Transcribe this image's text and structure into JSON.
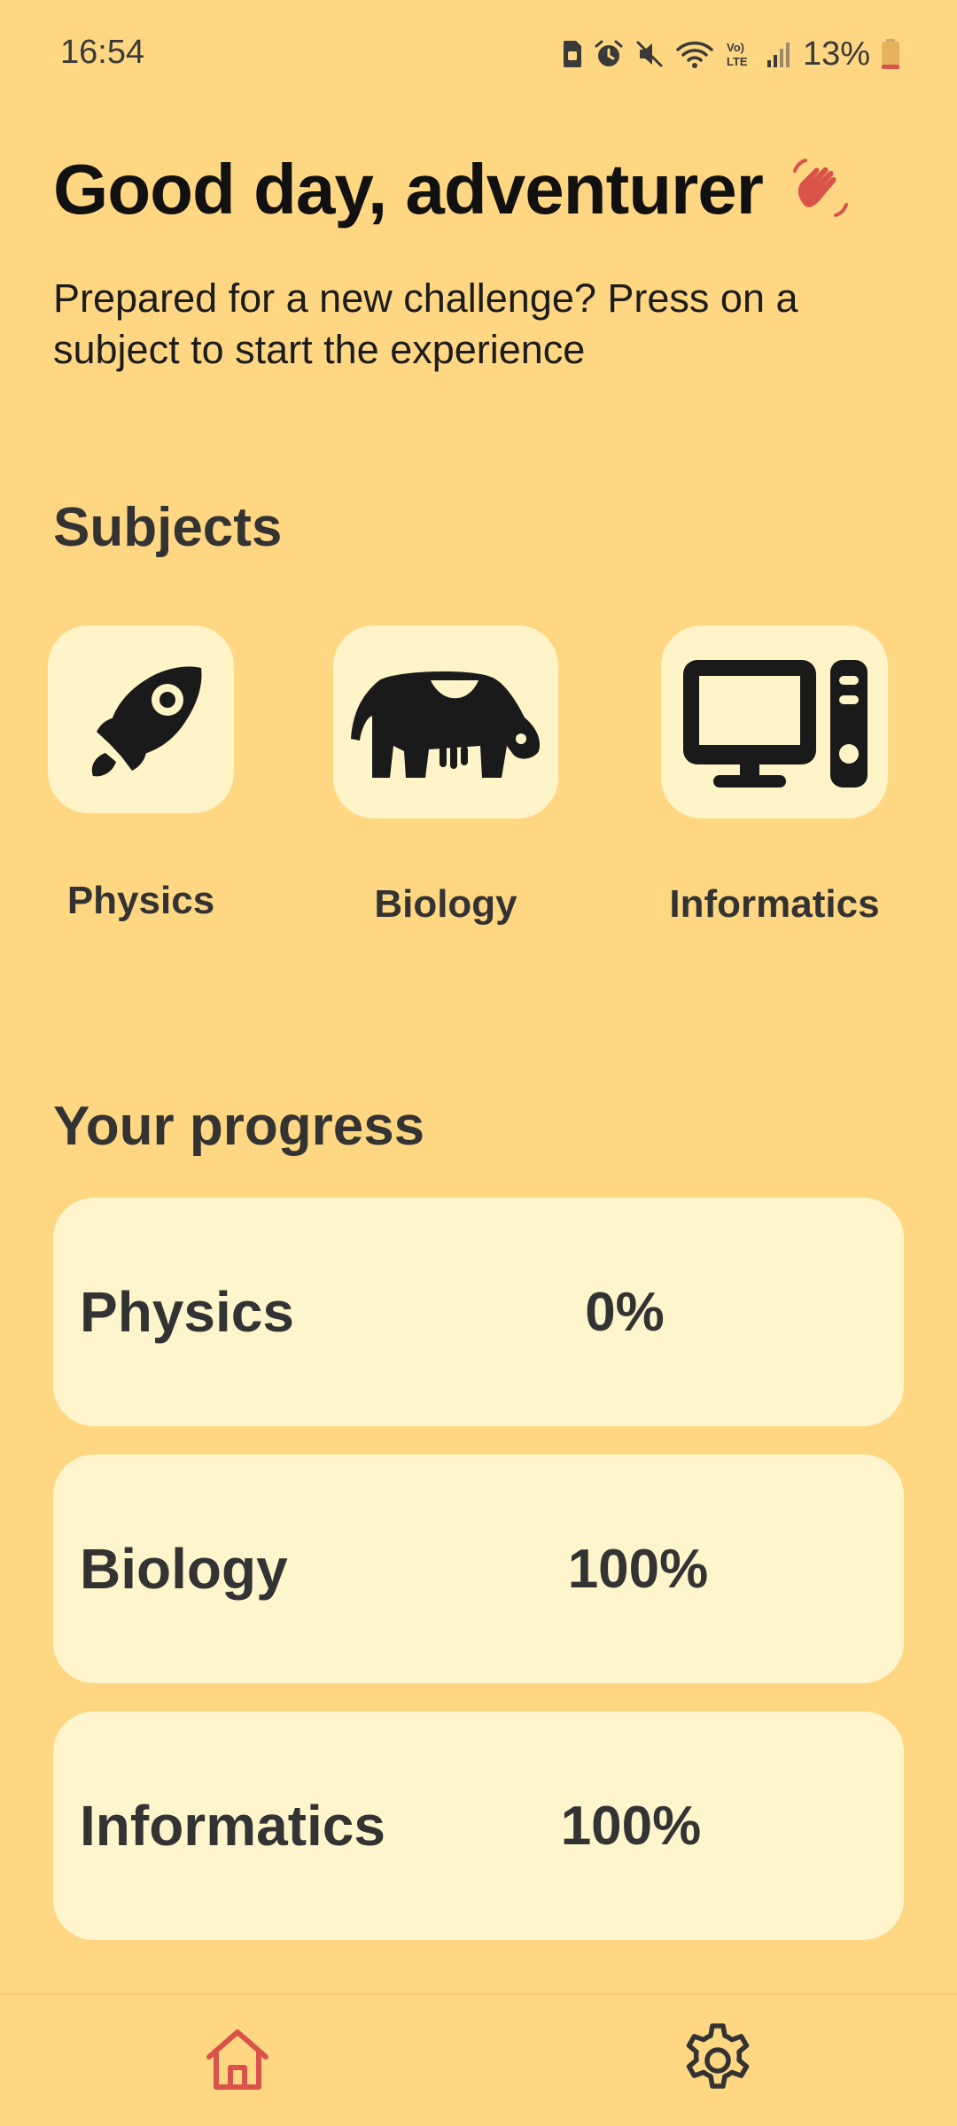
{
  "status_bar": {
    "time": "16:54",
    "battery_percent": "13%",
    "icons": [
      "sim-card-icon",
      "alarm-icon",
      "mute-icon",
      "wifi-icon",
      "volte-icon",
      "signal-icon",
      "battery-icon"
    ],
    "volte_label": "Vo) LTE"
  },
  "header": {
    "greeting": "Good day, adventurer",
    "greeting_icon": "waving-hand-icon",
    "subtitle": "Prepared for a new challenge? Press on a subject to start the experience"
  },
  "subjects": {
    "title": "Subjects",
    "items": [
      {
        "label": "Physics",
        "icon": "rocket-icon"
      },
      {
        "label": "Biology",
        "icon": "cow-icon"
      },
      {
        "label": "Informatics",
        "icon": "computer-icon"
      }
    ]
  },
  "progress": {
    "title": "Your progress",
    "items": [
      {
        "subject": "Physics",
        "value": "0%",
        "fraction": 0
      },
      {
        "subject": "Biology",
        "value": "100%",
        "fraction": 1
      },
      {
        "subject": "Informatics",
        "value": "100%",
        "fraction": 1
      }
    ]
  },
  "bottom_nav": {
    "items": [
      {
        "icon": "home-icon",
        "active": true
      },
      {
        "icon": "gear-icon",
        "active": false
      }
    ]
  },
  "colors": {
    "background": "#FFD783",
    "card": "#FFF3C8",
    "accent": "#D9534A",
    "text": "#333333"
  }
}
